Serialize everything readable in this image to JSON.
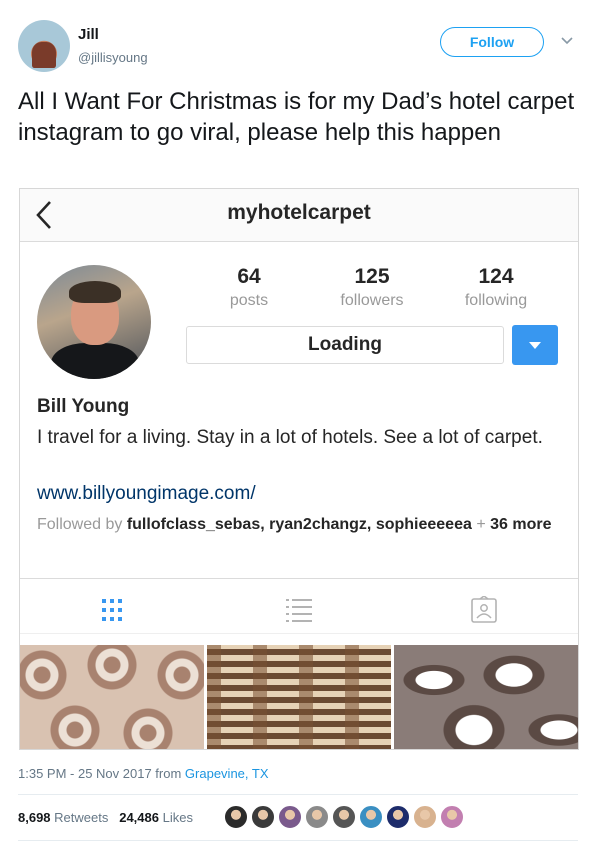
{
  "tweet": {
    "author_name": "Jill",
    "author_handle": "@jillisyoung",
    "follow_label": "Follow",
    "text": "All I Want For Christmas is for my Dad’s hotel carpet instagram to go viral, please help this happen",
    "timestamp": "1:35 PM - 25 Nov 2017 from ",
    "location": "Grapevine, TX",
    "retweets_count": "8,698",
    "retweets_label": "Retweets",
    "likes_count": "24,486",
    "likes_label": "Likes",
    "liker_colors": [
      "#2b2b2b",
      "#3a3a3a",
      "#7a5a8c",
      "#8a8a8a",
      "#555555",
      "#3a8fc2",
      "#1d2c6b",
      "#d8b28f",
      "#c27fb0"
    ]
  },
  "instagram": {
    "username": "myhotelcarpet",
    "stats": [
      {
        "value": "64",
        "label": "posts"
      },
      {
        "value": "125",
        "label": "followers"
      },
      {
        "value": "124",
        "label": "following"
      }
    ],
    "loading_label": "Loading",
    "name": "Bill Young",
    "bio": "I travel for a living. Stay in a lot of hotels. See a lot of carpet.",
    "website": "www.billyoungimage.com/",
    "followed_by_prefix": "Followed by ",
    "followed_by_users": "fullofclass_sebas, ryan2changz, sophieeeeea",
    "followed_by_more": "36 more"
  },
  "colors": {
    "twitter_blue": "#1da1f2",
    "instagram_blue": "#3897f0",
    "link_navy": "#003569"
  }
}
